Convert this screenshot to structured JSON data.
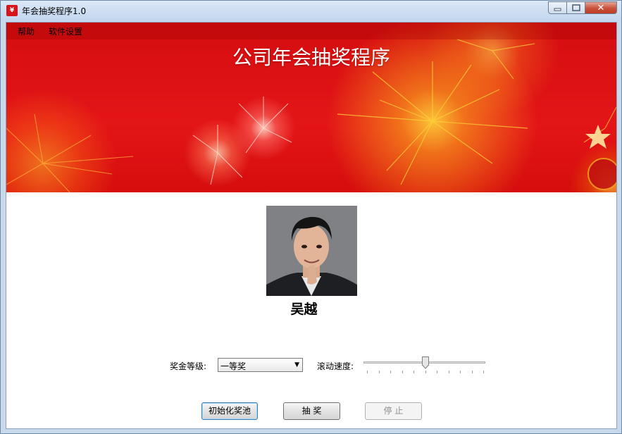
{
  "window": {
    "title": "年会抽奖程序1.0",
    "icon": "yen-red-envelope-icon"
  },
  "menu": {
    "items": [
      "帮助",
      "软件设置"
    ]
  },
  "banner": {
    "title": "公司年会抽奖程序"
  },
  "winner": {
    "name": "吴越"
  },
  "controls": {
    "prize_level_label": "奖金等级:",
    "prize_level_value": "一等奖",
    "scroll_speed_label": "滚动速度:",
    "scroll_speed_fraction": 0.5
  },
  "buttons": {
    "init": "初始化奖池",
    "draw": "抽 奖",
    "stop": "停 止"
  },
  "colors": {
    "banner_red": "#e31517",
    "primary_button_border": "#3c7fb1"
  }
}
